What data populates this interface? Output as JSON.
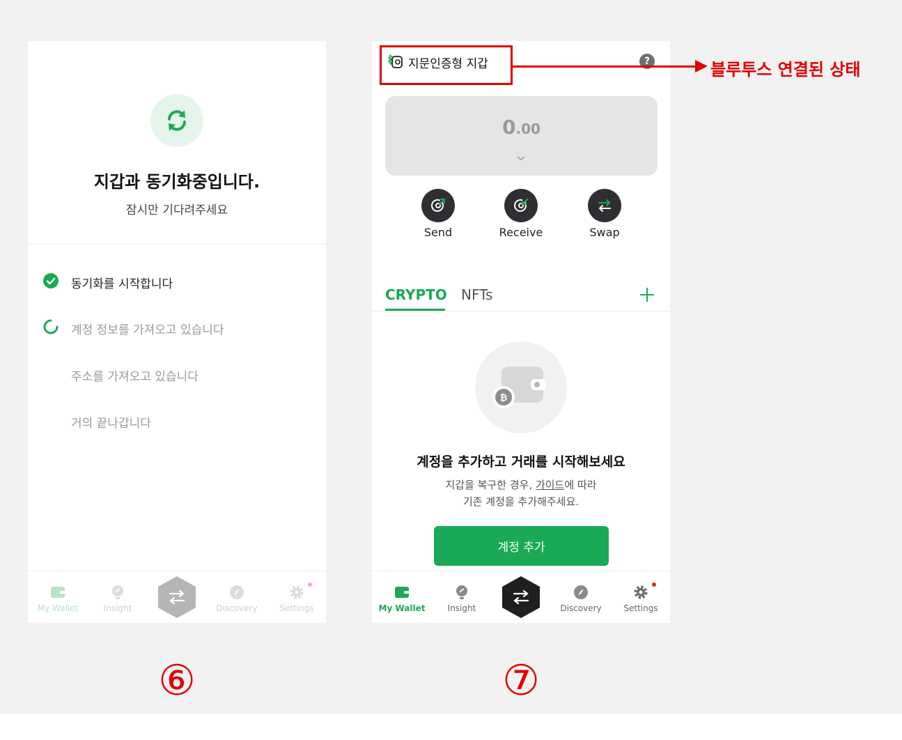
{
  "colors": {
    "accent_green": "#1aaa55",
    "annotation_red": "#e00000",
    "dark_button": "#2f2f33"
  },
  "phone1": {
    "sync_icon": "refresh-icon",
    "title": "지갑과 동기화중입니다.",
    "subtitle": "잠시만 기다려주세요",
    "steps": [
      {
        "label": "동기화를 시작합니다",
        "status": "done"
      },
      {
        "label": "계정 정보를 가져오고 있습니다",
        "status": "loading"
      },
      {
        "label": "주소를 가져오고 있습니다",
        "status": "pending"
      },
      {
        "label": "거의 끝나갑니다",
        "status": "pending"
      }
    ],
    "nav": {
      "items": [
        {
          "label": "My Wallet",
          "icon": "wallet-icon",
          "active": true
        },
        {
          "label": "Insight",
          "icon": "insight-icon"
        },
        {
          "label": "Discovery",
          "icon": "compass-icon"
        },
        {
          "label": "Settings",
          "icon": "gear-icon",
          "badge": true
        }
      ],
      "center_icon": "swap-arrows-icon"
    }
  },
  "phone2": {
    "wallet_title": "지문인증형 지갑",
    "bluetooth_icon": "bluetooth-icon",
    "help_label": "?",
    "balance": {
      "integer": "0",
      "decimal": ".00"
    },
    "actions": [
      {
        "label": "Send",
        "icon": "send-icon"
      },
      {
        "label": "Receive",
        "icon": "receive-icon"
      },
      {
        "label": "Swap",
        "icon": "swap-icon"
      }
    ],
    "tabs": [
      {
        "label": "CRYPTO",
        "active": true
      },
      {
        "label": "NFTs",
        "active": false
      }
    ],
    "empty_state": {
      "title": "계정을 추가하고 거래를 시작해보세요",
      "line1_prefix": "지갑을 복구한 경우, ",
      "line1_link": "가이드",
      "line1_suffix": "에 따라",
      "line2": "기존 계정을 추가해주세요."
    },
    "add_account_button": "계정 추가",
    "nav": {
      "items": [
        {
          "label": "My Wallet",
          "icon": "wallet-icon",
          "active": true
        },
        {
          "label": "Insight",
          "icon": "insight-icon"
        },
        {
          "label": "Discovery",
          "icon": "compass-icon"
        },
        {
          "label": "Settings",
          "icon": "gear-icon",
          "badge": true
        }
      ],
      "center_icon": "swap-arrows-icon"
    }
  },
  "annotations": {
    "bluetooth_note": "블루투스 연결된 상태",
    "step6": "⑥",
    "step7": "⑦"
  }
}
